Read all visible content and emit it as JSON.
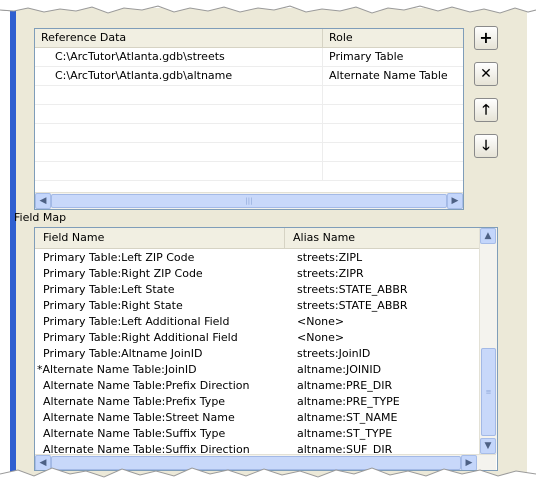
{
  "reference_data": {
    "columns": [
      "Reference Data",
      "Role"
    ],
    "rows": [
      {
        "path": "C:\\ArcTutor\\Atlanta.gdb\\streets",
        "role": "Primary Table"
      },
      {
        "path": "C:\\ArcTutor\\Atlanta.gdb\\altname",
        "role": "Alternate Name Table"
      }
    ]
  },
  "side_buttons": {
    "add": "+",
    "remove": "✕",
    "move_up": "🡑",
    "move_down": "🡓"
  },
  "field_map": {
    "label": "Field Map",
    "columns": [
      "Field Name",
      "Alias Name"
    ],
    "rows": [
      {
        "field": "Primary Table:Left ZIP Code",
        "alias": "streets:ZIPL"
      },
      {
        "field": "Primary Table:Right ZIP Code",
        "alias": "streets:ZIPR"
      },
      {
        "field": "Primary Table:Left State",
        "alias": "streets:STATE_ABBR"
      },
      {
        "field": "Primary Table:Right State",
        "alias": "streets:STATE_ABBR"
      },
      {
        "field": "Primary Table:Left Additional Field",
        "alias": "<None>"
      },
      {
        "field": "Primary Table:Right Additional Field",
        "alias": "<None>"
      },
      {
        "field": "Primary Table:Altname JoinID",
        "alias": "streets:JoinID"
      },
      {
        "field": "*Alternate Name Table:JoinID",
        "alias": "altname:JOINID"
      },
      {
        "field": "Alternate Name Table:Prefix Direction",
        "alias": "altname:PRE_DIR"
      },
      {
        "field": "Alternate Name Table:Prefix Type",
        "alias": "altname:PRE_TYPE"
      },
      {
        "field": "Alternate Name Table:Street Name",
        "alias": "altname:ST_NAME"
      },
      {
        "field": "Alternate Name Table:Suffix Type",
        "alias": "altname:ST_TYPE"
      },
      {
        "field": "Alternate Name Table:Suffix Direction",
        "alias": "altname:SUF_DIR"
      }
    ]
  },
  "icons": {
    "scroll_left": "◀",
    "scroll_right": "▶",
    "scroll_up": "▲",
    "scroll_down": "▼",
    "grip_h": "|||",
    "grip_v": "≡"
  },
  "colors": {
    "dialog_bg": "#ECE9D8",
    "list_border": "#7f9db9",
    "scroll_blue": "#c4d6fb"
  }
}
